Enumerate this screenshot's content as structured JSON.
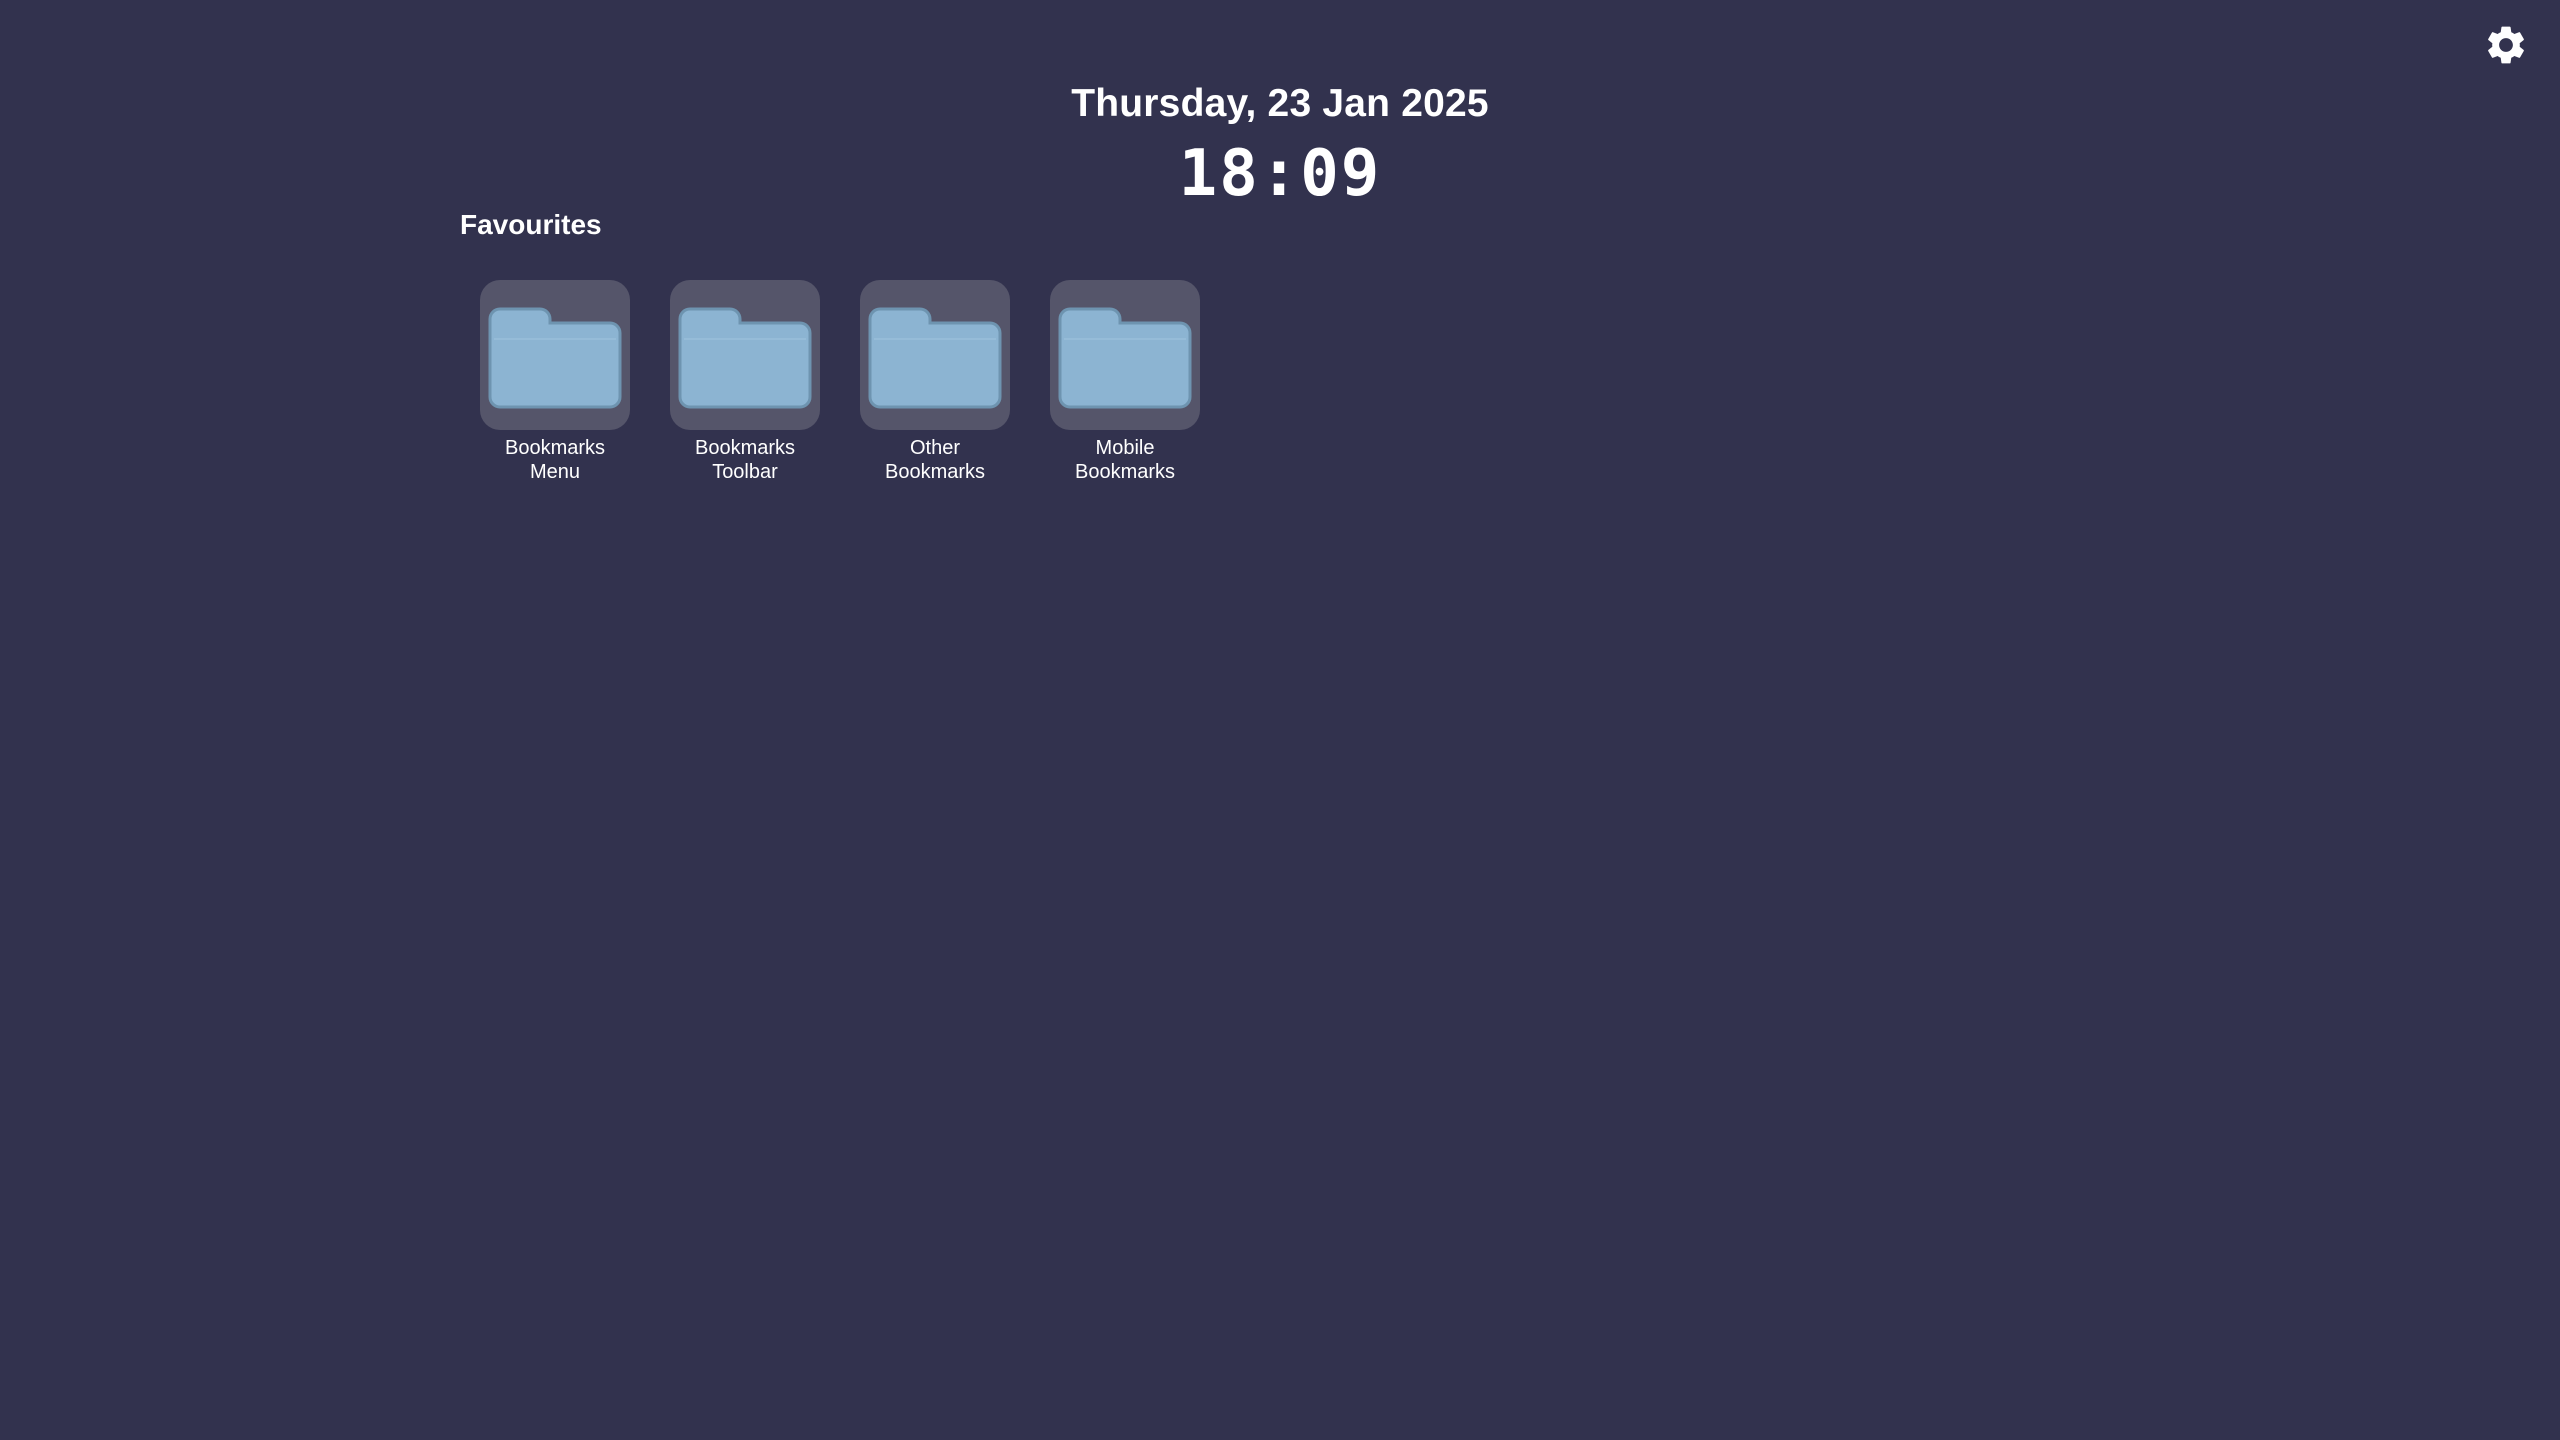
{
  "header": {
    "date": "Thursday, 23 Jan 2025",
    "time": "18:09"
  },
  "settings": {
    "icon": "gear-icon"
  },
  "favourites": {
    "title": "Favourites",
    "items": [
      {
        "label": "Bookmarks\nMenu",
        "icon": "folder-icon"
      },
      {
        "label": "Bookmarks\nToolbar",
        "icon": "folder-icon"
      },
      {
        "label": "Other\nBookmarks",
        "icon": "folder-icon"
      },
      {
        "label": "Mobile\nBookmarks",
        "icon": "folder-icon"
      }
    ]
  },
  "colors": {
    "background": "#32324e",
    "tile": "#55556a",
    "folder": "#8cb4d2",
    "text": "#ffffff"
  }
}
